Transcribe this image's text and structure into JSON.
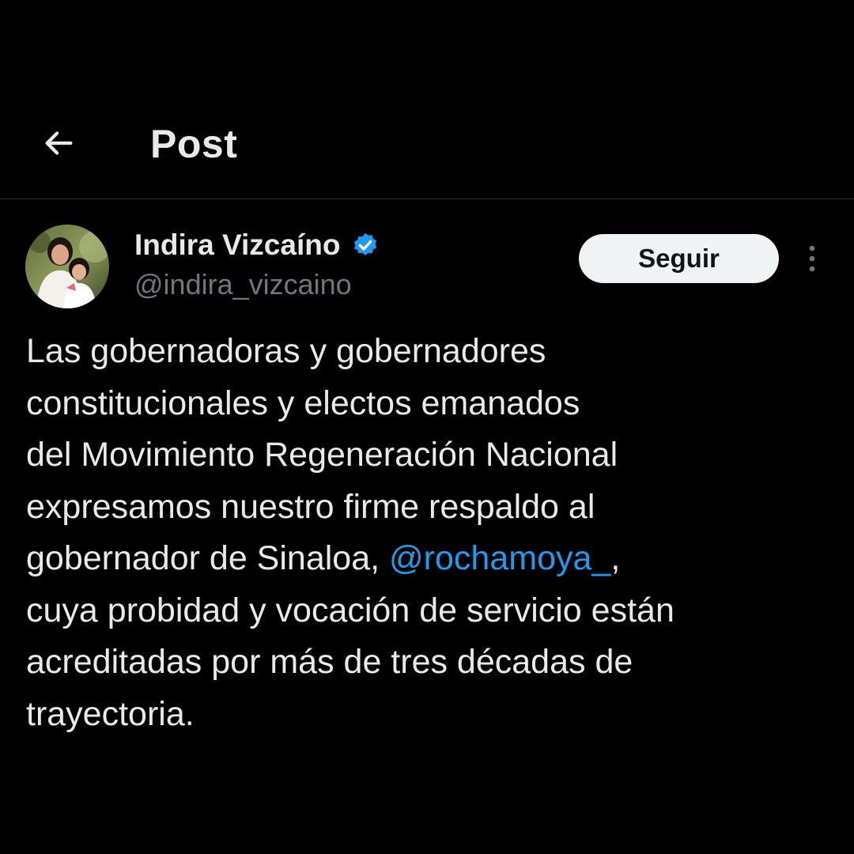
{
  "header": {
    "back_icon": "arrow-left-icon",
    "title": "Post"
  },
  "author": {
    "display_name": "Indira Vizcaíno",
    "handle": "@indira_vizcaino",
    "verified_icon": "verified-badge-icon",
    "verified_color": "#1d9bf0"
  },
  "follow_button": {
    "label": "Seguir"
  },
  "more_icon": "more-vertical-icon",
  "tweet": {
    "line1": "Las gobernadoras y gobernadores",
    "line2": "constitucionales y electos emanados",
    "line3": "del Movimiento Regeneración Nacional",
    "line4": "expresamos nuestro firme respaldo al",
    "line5_before": "gobernador de Sinaloa, ",
    "mention": "@rochamoya_",
    "line5_after": ",",
    "line6": "cuya probidad y vocación de servicio están",
    "line7": "acreditadas por más de tres décadas de",
    "line8": "trayectoria."
  },
  "colors": {
    "background": "#000000",
    "text": "#e7e9ea",
    "secondary_text": "#71767b",
    "link": "#1d9bf0",
    "divider": "#2f3336",
    "button_bg": "#eff3f4"
  }
}
